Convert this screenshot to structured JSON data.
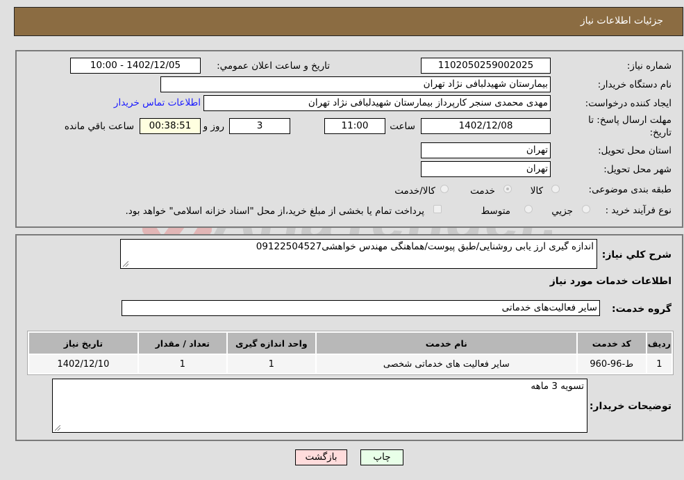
{
  "header": {
    "title": "جزئیات اطلاعات نیاز"
  },
  "form": {
    "need_number": {
      "label": "شماره نیاز:",
      "value": "1102050259002025"
    },
    "announce_datetime": {
      "label": "تاریخ و ساعت اعلان عمومي:",
      "value": "1402/12/05 - 10:00"
    },
    "buyer_org": {
      "label": "نام دستگاه خریدار:",
      "value": "بیمارستان شهیدلبافی نژاد تهران"
    },
    "requester": {
      "label": "ایجاد کننده درخواست:",
      "value": "مهدی محمدی سنجر کارپرداز بیمارستان شهیدلبافی نژاد تهران"
    },
    "buyer_contact_link": "اطلاعات تماس خریدار",
    "deadline": {
      "label": "مهلت ارسال پاسخ: تا تاریخ:",
      "date": "1402/12/08",
      "time_label": "ساعت",
      "time": "11:00",
      "days": "3",
      "days_label": "روز و",
      "remaining": "00:38:51",
      "remaining_label": "ساعت باقي مانده"
    },
    "province": {
      "label": "استان محل تحویل:",
      "value": "تهران"
    },
    "city": {
      "label": "شهر محل تحویل:",
      "value": "تهران"
    },
    "category": {
      "label": "طبقه بندی موضوعی:",
      "options": [
        "کالا",
        "خدمت",
        "کالا/خدمت"
      ],
      "selected": "خدمت"
    },
    "purchase_process": {
      "label": "نوع فرآیند خرید :",
      "options": [
        "جزيي",
        "متوسط"
      ],
      "checkbox_label": "پرداخت تمام یا بخشی از مبلغ خرید،از محل \"اسناد خزانه اسلامی\" خواهد بود."
    }
  },
  "description": {
    "label": "شرح کلي نياز:",
    "value": "اندازه گیری ارز یابی روشنایی/طبق پیوست/هماهنگی مهندس خواهشی09122504527"
  },
  "services": {
    "section_title": "اطلاعات خدمات مورد نياز",
    "group_label": "گروه خدمت:",
    "group_value": "سایر فعالیت‌های خدماتی",
    "table": {
      "headers": [
        "رديف",
        "کد خدمت",
        "نام خدمت",
        "واحد اندازه گیری",
        "تعداد / مقدار",
        "تاریخ نیاز"
      ],
      "rows": [
        [
          "1",
          "ط-96-960",
          "سایر فعالیت های خدماتی شخصی",
          "1",
          "1",
          "1402/12/10"
        ]
      ]
    }
  },
  "buyer_notes": {
    "label": "توضیحات خریدار:",
    "value": "تسویه 3 ماهه"
  },
  "buttons": {
    "print": "چاپ",
    "back": "بازگشت"
  },
  "watermark": {
    "text": "AriaTender.neT"
  },
  "colors": {
    "header_bg": "#8b6c42",
    "print_btn": "#e8ffe8",
    "back_btn": "#ffdcdc",
    "link": "#1a1aff"
  }
}
